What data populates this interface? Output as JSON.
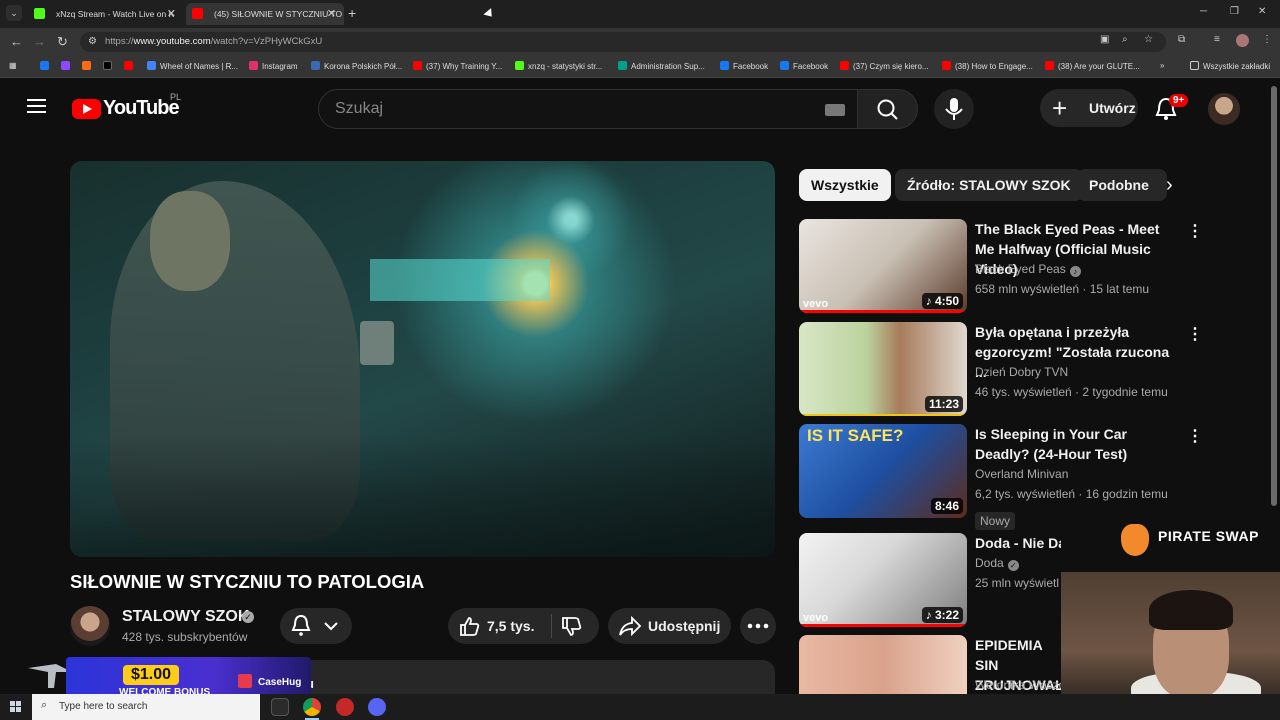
{
  "browser": {
    "tabs": [
      {
        "label": "xNzq Stream - Watch Live on K",
        "favicon_color": "#53fc18"
      },
      {
        "label": "(45) SIŁOWNIE W STYCZNIU TO",
        "favicon_color": "#ff0000"
      }
    ],
    "url_prefix": "https://",
    "url_host": "www.youtube.com",
    "url_path": "/watch?v=VzPHyWCkGxU",
    "bookmarks": [
      {
        "label": "Wheel of Names | R...",
        "color": "#4285f4"
      },
      {
        "label": "Instagram",
        "color": "#e1306c"
      },
      {
        "label": "Korona Polskich Pół...",
        "color": "#3a6ab4"
      },
      {
        "label": "(37) Why Training Y...",
        "color": "#ff0000"
      },
      {
        "label": "xnzq - statystyki str...",
        "color": "#53fc18"
      },
      {
        "label": "Administration Sup...",
        "color": "#00a28a"
      },
      {
        "label": "Facebook",
        "color": "#1877f2"
      },
      {
        "label": "Facebook",
        "color": "#1877f2"
      },
      {
        "label": "(37) Czym się kiero...",
        "color": "#ff0000"
      },
      {
        "label": "(38) How to Engage...",
        "color": "#ff0000"
      },
      {
        "label": "(38) Are your GLUTE...",
        "color": "#ff0000"
      }
    ],
    "all_bookmarks_label": "Wszystkie zakładki"
  },
  "youtube": {
    "logo_word": "YouTube",
    "country_code": "PL",
    "search_placeholder": "Szukaj",
    "create_label": "Utwórz",
    "notification_count": "9+"
  },
  "video": {
    "title": "SIŁOWNIE W STYCZNIU TO PATOLOGIA",
    "channel_name": "STALOWY SZOK",
    "subscribers": "428 tys. subskrybentów",
    "likes": "7,5 tys.",
    "share_label": "Udostępnij",
    "description_partial": "u"
  },
  "promo": {
    "amount": "$1.00",
    "text": "WELCOME BONUS",
    "brand": "CaseHug"
  },
  "sidebar": {
    "chips": [
      "Wszystkie",
      "Źródło: STALOWY SZOK",
      "Podobne"
    ],
    "recommendations": [
      {
        "title": "The Black Eyed Peas - Meet Me Halfway (Official Music Video)",
        "channel": "Black Eyed Peas",
        "meta": "658 mln wyświetleń · 15 lat temu",
        "duration": "4:50",
        "vevo": "vevo"
      },
      {
        "title": "Była opętana i przeżyła egzorcyzm! \"Została rzucona ...",
        "channel": "Dzień Dobry TVN",
        "meta": "46 tys. wyświetleń · 2 tygodnie temu",
        "duration": "11:23"
      },
      {
        "title": "Is Sleeping in Your Car Deadly? (24-Hour Test)",
        "channel": "Overland Minivan",
        "meta": "6,2 tys. wyświetleń · 16 godzin temu",
        "duration": "8:46",
        "badge": "Nowy",
        "thumb_text": "IS IT SAFE?"
      },
      {
        "title": "Doda - Nie Da",
        "channel": "Doda",
        "meta": "25 mln wyświetl",
        "duration": "3:22",
        "vevo": "vevo"
      },
      {
        "title": "EPIDEMIA SIN ZRUJNOWAŁ",
        "channel": "Weronika Woszc"
      }
    ]
  },
  "overlay": {
    "sponsor": "PIRATE SWAP"
  },
  "taskbar": {
    "search_placeholder": "Type here to search"
  }
}
